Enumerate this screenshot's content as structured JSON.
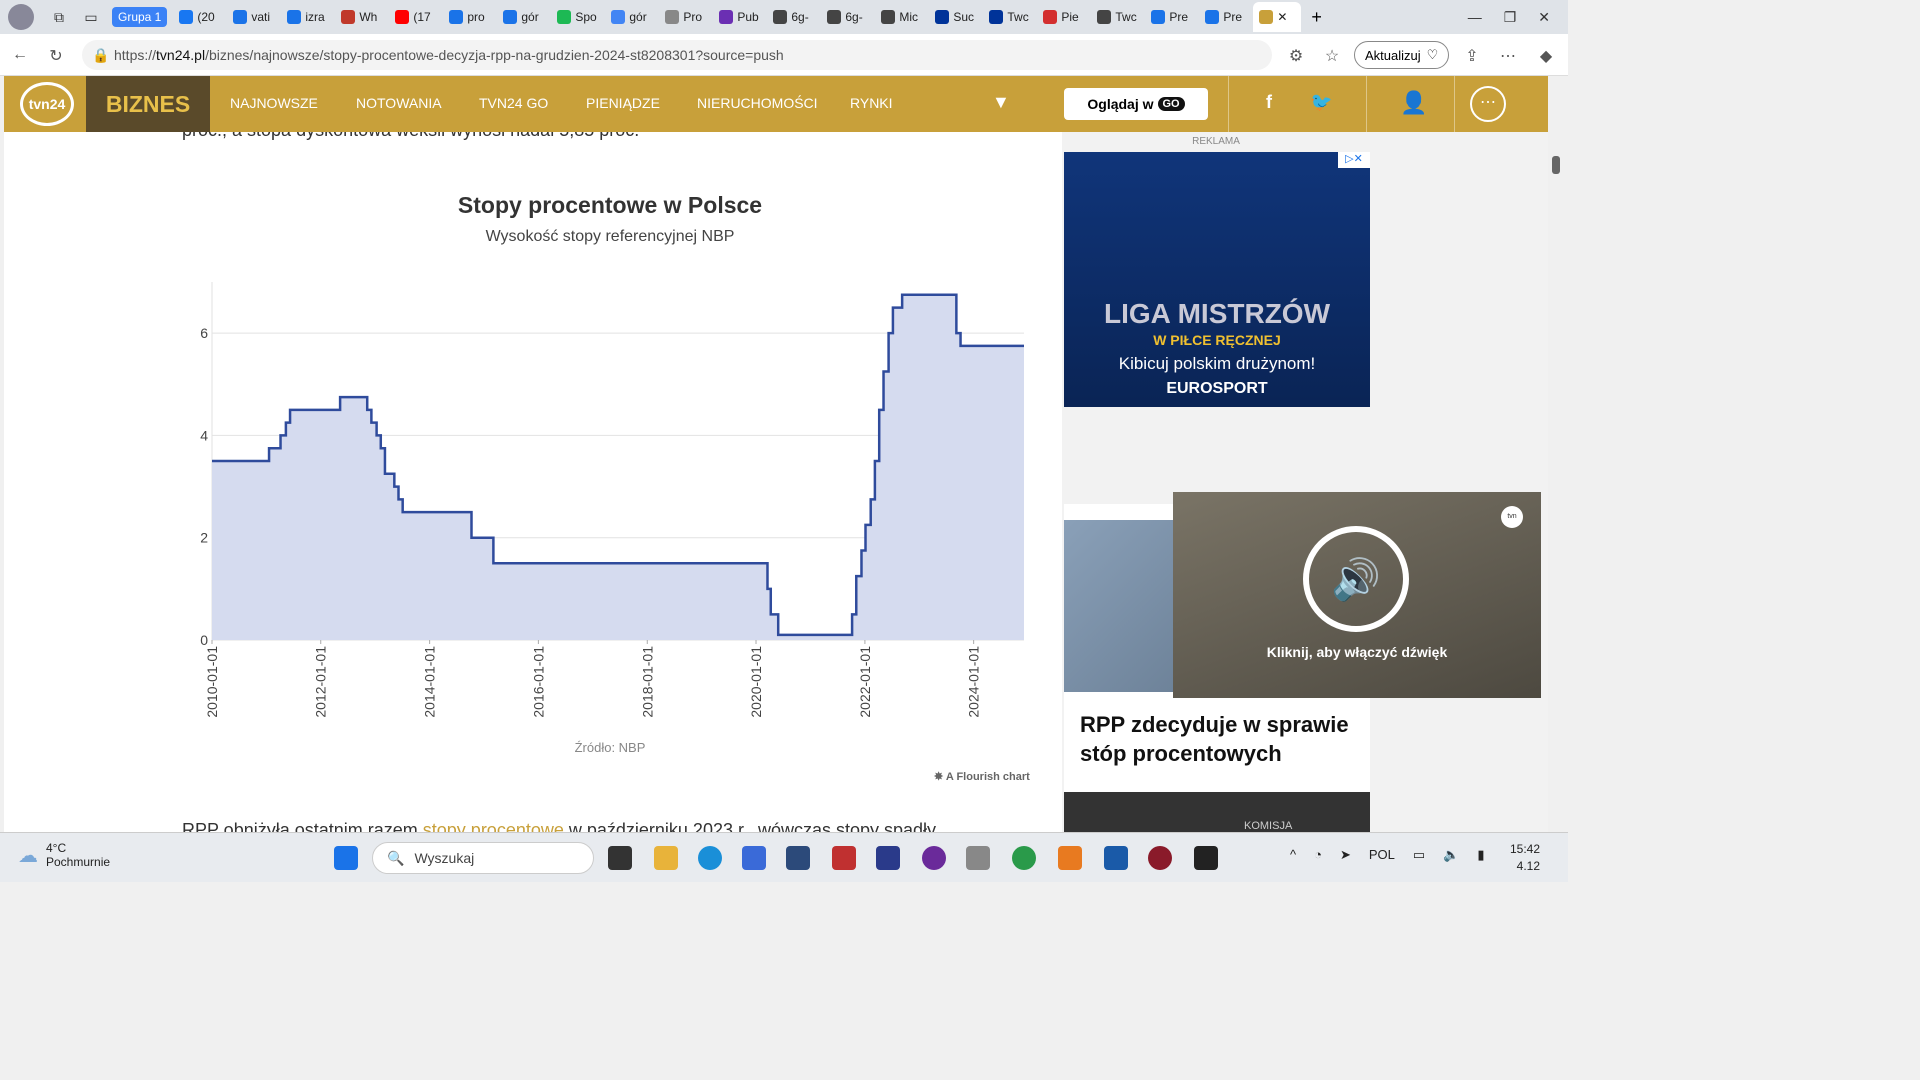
{
  "browser": {
    "group_label": "Grupa 1",
    "tabs": [
      {
        "label": "(20",
        "color": "#1877f2"
      },
      {
        "label": "vati",
        "color": "#1a73e8"
      },
      {
        "label": "izra",
        "color": "#1a73e8"
      },
      {
        "label": "Wh",
        "color": "#c0392b"
      },
      {
        "label": "(17",
        "color": "#ff0000"
      },
      {
        "label": "pro",
        "color": "#1a73e8"
      },
      {
        "label": "gór",
        "color": "#1a73e8"
      },
      {
        "label": "Spo",
        "color": "#1db954"
      },
      {
        "label": "gór",
        "color": "#4285f4"
      },
      {
        "label": "Pro",
        "color": "#888888"
      },
      {
        "label": "Pub",
        "color": "#6b2fb3"
      },
      {
        "label": "6g-",
        "color": "#444444"
      },
      {
        "label": "6g-",
        "color": "#444444"
      },
      {
        "label": "Mic",
        "color": "#444444"
      },
      {
        "label": "Suc",
        "color": "#003399"
      },
      {
        "label": "Twc",
        "color": "#003399"
      },
      {
        "label": "Pie",
        "color": "#d32f2f"
      },
      {
        "label": "Twc",
        "color": "#444444"
      },
      {
        "label": "Pre",
        "color": "#1a73e8"
      },
      {
        "label": "Pre",
        "color": "#1a73e8"
      }
    ],
    "url_prefix": "https://",
    "url_domain": "tvn24.pl",
    "url_path": "/biznes/najnowsze/stopy-procentowe-decyzja-rpp-na-grudzien-2024-st8208301?source=push",
    "update_button": "Aktualizuj"
  },
  "site": {
    "logo": "tvn24",
    "section": "BIZNES",
    "nav": [
      "NAJNOWSZE",
      "NOTOWANIA",
      "TVN24 GO",
      "PIENIĄDZE",
      "NIERUCHOMOŚCI",
      "RYNKI"
    ],
    "watch_button": "Oglądaj w",
    "watch_brand": "GO"
  },
  "article": {
    "intro": "proc., a stopa dyskontowa weksli wynosi nadal 5,85 proc.",
    "bottom_text_a": "RPP obniżyła ostatnim razem ",
    "bottom_link": "stopy procentowe",
    "bottom_text_b": " w październiku 2023 r., wówczas stopy spadły"
  },
  "chart_data": {
    "type": "area",
    "title": "Stopy procentowe w Polsce",
    "subtitle": "Wysokość stopy referencyjnej NBP",
    "source": "Źródło: NBP",
    "credit": "A Flourish chart",
    "ylim": [
      0,
      7
    ],
    "yticks": [
      0,
      2,
      4,
      6
    ],
    "xticks": [
      "2010-01-01",
      "2012-01-01",
      "2014-01-01",
      "2016-01-01",
      "2018-01-01",
      "2020-01-01",
      "2022-01-01",
      "2024-01-01"
    ],
    "step": true,
    "color": "#2f4b9c",
    "fill": "#d5dbef",
    "points": [
      [
        "2010-01-01",
        3.5
      ],
      [
        "2011-01-19",
        3.75
      ],
      [
        "2011-04-06",
        4.0
      ],
      [
        "2011-05-12",
        4.25
      ],
      [
        "2011-06-09",
        4.5
      ],
      [
        "2012-05-10",
        4.75
      ],
      [
        "2012-11-08",
        4.5
      ],
      [
        "2012-12-06",
        4.25
      ],
      [
        "2013-01-10",
        4.0
      ],
      [
        "2013-02-07",
        3.75
      ],
      [
        "2013-03-07",
        3.25
      ],
      [
        "2013-05-09",
        3.0
      ],
      [
        "2013-06-06",
        2.75
      ],
      [
        "2013-07-04",
        2.5
      ],
      [
        "2014-10-09",
        2.0
      ],
      [
        "2015-03-05",
        1.5
      ],
      [
        "2020-03-18",
        1.0
      ],
      [
        "2020-04-09",
        0.5
      ],
      [
        "2020-05-29",
        0.1
      ],
      [
        "2021-10-07",
        0.5
      ],
      [
        "2021-11-04",
        1.25
      ],
      [
        "2021-12-09",
        1.75
      ],
      [
        "2022-01-05",
        2.25
      ],
      [
        "2022-02-09",
        2.75
      ],
      [
        "2022-03-09",
        3.5
      ],
      [
        "2022-04-07",
        4.5
      ],
      [
        "2022-05-06",
        5.25
      ],
      [
        "2022-06-09",
        6.0
      ],
      [
        "2022-07-08",
        6.5
      ],
      [
        "2022-09-08",
        6.75
      ],
      [
        "2023-09-07",
        6.0
      ],
      [
        "2023-10-05",
        5.75
      ],
      [
        "2024-12-04",
        5.75
      ]
    ]
  },
  "sidebar": {
    "ad_label": "REKLAMA",
    "ad_title": "LIGA MISTRZÓW",
    "ad_subtitle": "W PIŁCE RĘCZNEJ",
    "ad_slogan": "Kibicuj polskim drużynom!",
    "ad_brand": "EUROSPORT",
    "news_title": "RPP zdecyduje w sprawie stóp procentowych",
    "news2_label": "KOMISJA"
  },
  "video": {
    "hint": "Kliknij, aby włączyć dźwięk",
    "badge": "tvn"
  },
  "taskbar": {
    "temp": "4°C",
    "weather": "Pochmurnie",
    "search_placeholder": "Wyszukaj",
    "lang": "POL",
    "time": "15:42",
    "date": "4.12"
  }
}
